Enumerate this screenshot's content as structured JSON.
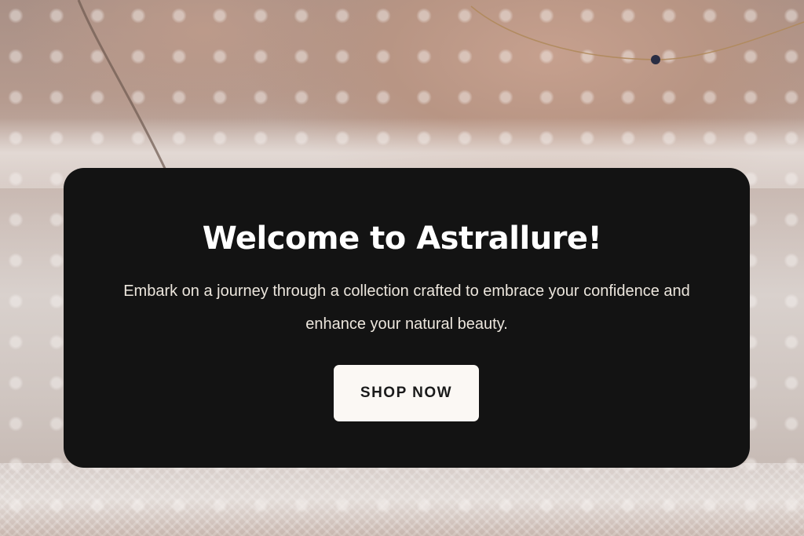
{
  "hero": {
    "title": "Welcome to Astrallure!",
    "subtitle": "Embark on a journey through a collection crafted to embrace your confidence and enhance your natural beauty.",
    "cta_label": "SHOP NOW"
  },
  "colors": {
    "card_background": "#131313",
    "card_text": "#ece6dd",
    "button_background": "#fbf8f4",
    "button_text": "#1a1a1a"
  }
}
